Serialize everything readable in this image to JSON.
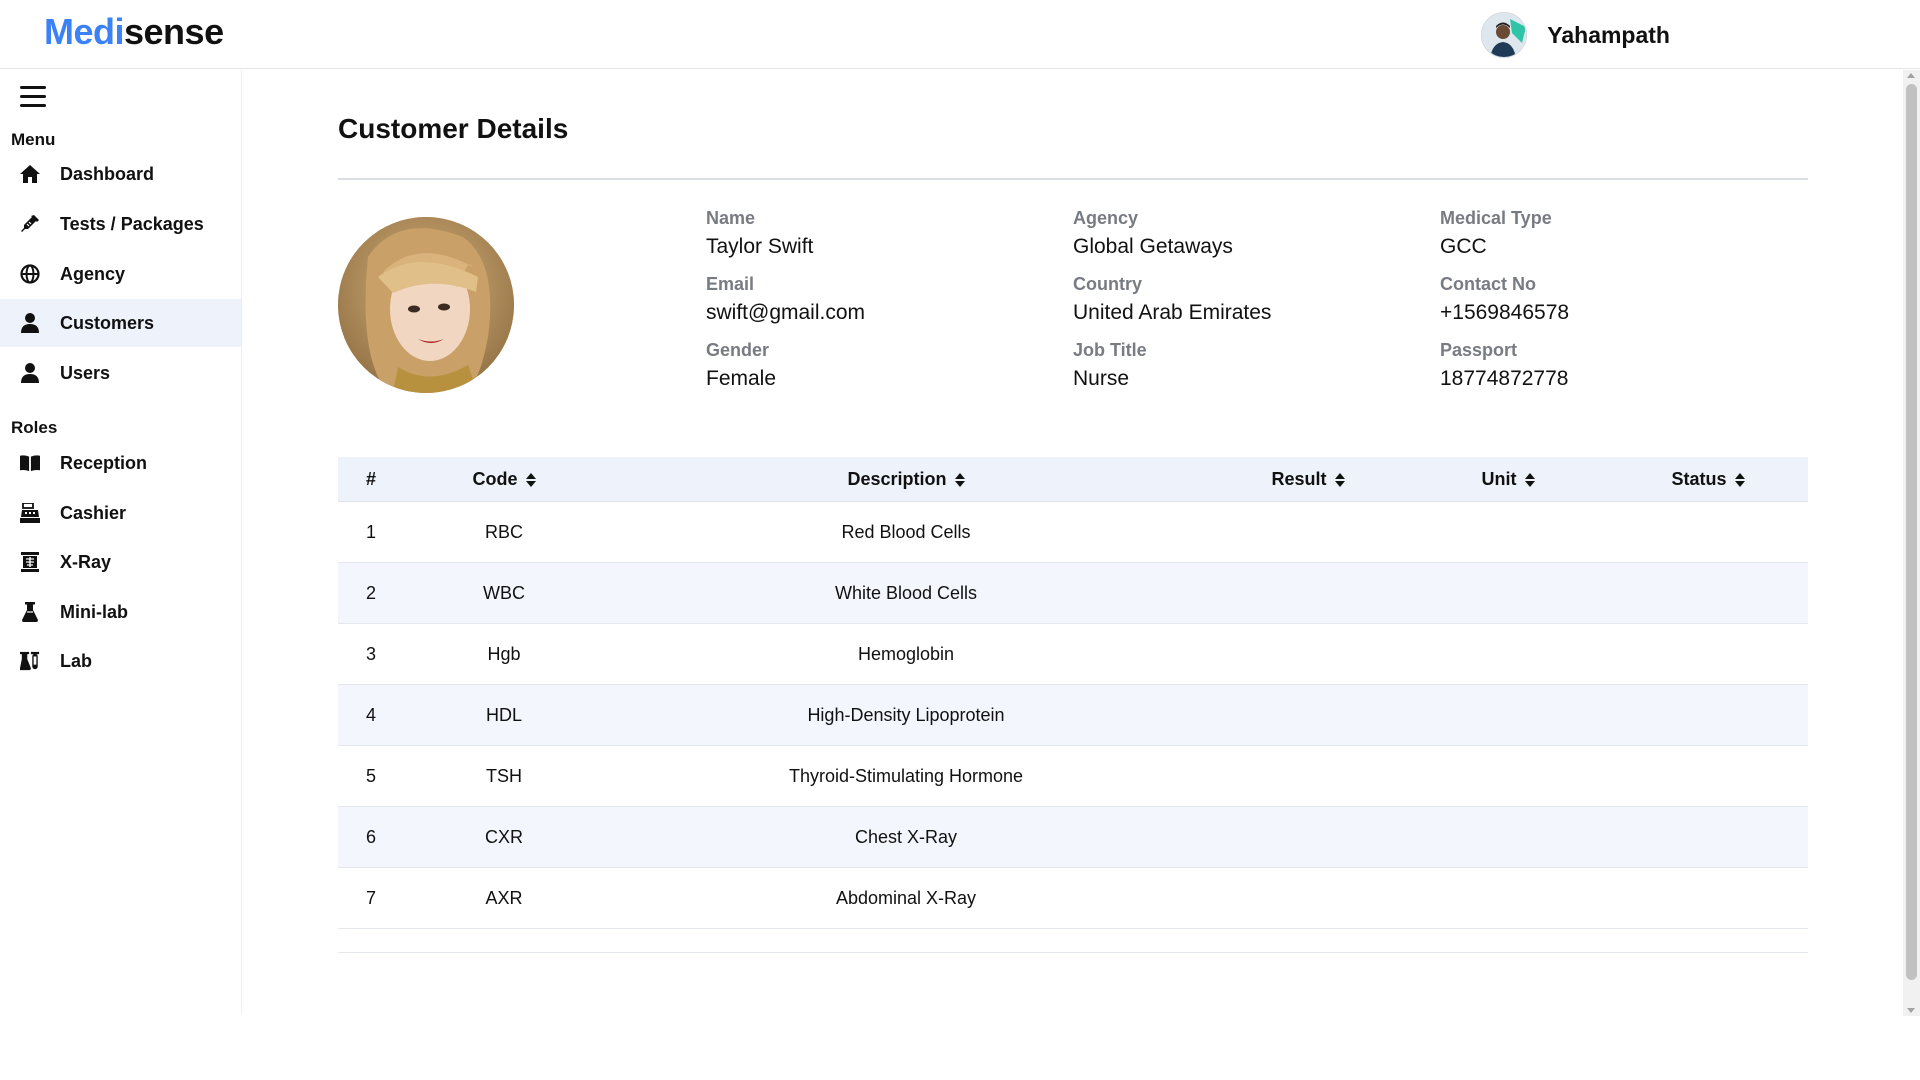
{
  "app": {
    "brand_part1": "Medi",
    "brand_part2": "sense",
    "brand_color": "#3b82f6"
  },
  "user": {
    "name": "Yahampath"
  },
  "sidebar": {
    "menu_label": "Menu",
    "menu_items": [
      {
        "label": "Dashboard",
        "icon": "home-icon",
        "active": false
      },
      {
        "label": "Tests / Packages",
        "icon": "syringe-icon",
        "active": false
      },
      {
        "label": "Agency",
        "icon": "globe-icon",
        "active": false
      },
      {
        "label": "Customers",
        "icon": "user-icon",
        "active": true
      },
      {
        "label": "Users",
        "icon": "user-icon",
        "active": false
      }
    ],
    "roles_label": "Roles",
    "role_items": [
      {
        "label": "Reception",
        "icon": "book-open-icon"
      },
      {
        "label": "Cashier",
        "icon": "cash-register-icon"
      },
      {
        "label": "X-Ray",
        "icon": "x-ray-icon"
      },
      {
        "label": "Mini-lab",
        "icon": "flask-icon"
      },
      {
        "label": "Lab",
        "icon": "flask-vial-icon"
      }
    ]
  },
  "page": {
    "title": "Customer Details"
  },
  "customer": {
    "name_label": "Name",
    "name": "Taylor Swift",
    "agency_label": "Agency",
    "agency": "Global Getaways",
    "medical_type_label": "Medical Type",
    "medical_type": "GCC",
    "email_label": "Email",
    "email": "swift@gmail.com",
    "country_label": "Country",
    "country": "United Arab Emirates",
    "contact_label": "Contact No",
    "contact": "+1569846578",
    "gender_label": "Gender",
    "gender": "Female",
    "job_title_label": "Job Title",
    "job_title": "Nurse",
    "passport_label": "Passport",
    "passport": "18774872778"
  },
  "table": {
    "headers": {
      "index": "#",
      "code": "Code",
      "description": "Description",
      "result": "Result",
      "unit": "Unit",
      "status": "Status"
    },
    "rows": [
      {
        "index": "1",
        "code": "RBC",
        "description": "Red Blood Cells",
        "result": "",
        "unit": "",
        "status": ""
      },
      {
        "index": "2",
        "code": "WBC",
        "description": "White Blood Cells",
        "result": "",
        "unit": "",
        "status": ""
      },
      {
        "index": "3",
        "code": "Hgb",
        "description": "Hemoglobin",
        "result": "",
        "unit": "",
        "status": ""
      },
      {
        "index": "4",
        "code": "HDL",
        "description": "High-Density Lipoprotein",
        "result": "",
        "unit": "",
        "status": ""
      },
      {
        "index": "5",
        "code": "TSH",
        "description": "Thyroid-Stimulating Hormone",
        "result": "",
        "unit": "",
        "status": ""
      },
      {
        "index": "6",
        "code": "CXR",
        "description": "Chest X-Ray",
        "result": "",
        "unit": "",
        "status": ""
      },
      {
        "index": "7",
        "code": "AXR",
        "description": "Abdominal X-Ray",
        "result": "",
        "unit": "",
        "status": ""
      }
    ]
  }
}
